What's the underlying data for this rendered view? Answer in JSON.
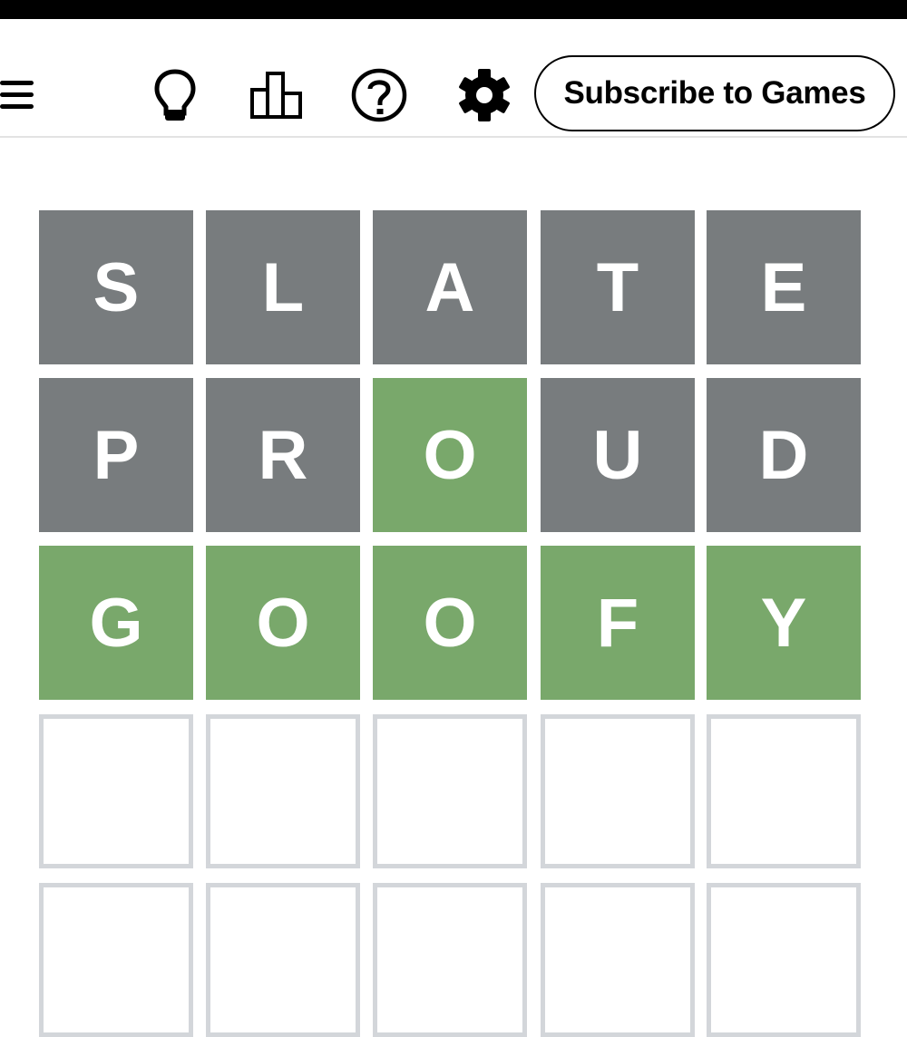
{
  "header": {
    "icons": [
      "menu-icon",
      "hint-lightbulb-icon",
      "stats-bar-chart-icon",
      "help-question-icon",
      "settings-gear-icon"
    ],
    "subscribe_label": "Subscribe to Games"
  },
  "colors": {
    "absent": "#787c7e",
    "correct": "#79a86b",
    "empty_border": "#d3d6da"
  },
  "board": {
    "rows": [
      {
        "letters": [
          "S",
          "L",
          "A",
          "T",
          "E"
        ],
        "states": [
          "absent",
          "absent",
          "absent",
          "absent",
          "absent"
        ]
      },
      {
        "letters": [
          "P",
          "R",
          "O",
          "U",
          "D"
        ],
        "states": [
          "absent",
          "absent",
          "correct",
          "absent",
          "absent"
        ]
      },
      {
        "letters": [
          "G",
          "O",
          "O",
          "F",
          "Y"
        ],
        "states": [
          "correct",
          "correct",
          "correct",
          "correct",
          "correct"
        ]
      },
      {
        "letters": [
          "",
          "",
          "",
          "",
          ""
        ],
        "states": [
          "empty",
          "empty",
          "empty",
          "empty",
          "empty"
        ]
      },
      {
        "letters": [
          "",
          "",
          "",
          "",
          ""
        ],
        "states": [
          "empty",
          "empty",
          "empty",
          "empty",
          "empty"
        ]
      }
    ]
  }
}
